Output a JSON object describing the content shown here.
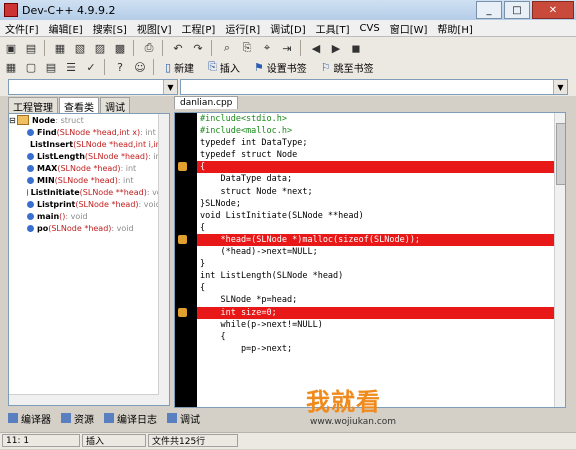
{
  "window": {
    "title": "Dev-C++ 4.9.9.2"
  },
  "menu": [
    "文件[F]",
    "编辑[E]",
    "搜索[S]",
    "视图[V]",
    "工程[P]",
    "运行[R]",
    "调试[D]",
    "工具[T]",
    "CVS",
    "窗口[W]",
    "帮助[H]"
  ],
  "toolbar2": {
    "new_label": "新建",
    "insert_label": "插入",
    "set_bookmark_label": "设置书签",
    "goto_bookmark_label": "跳至书签"
  },
  "left_tabs": [
    "工程管理",
    "查看类",
    "调试"
  ],
  "class_tree": {
    "root": {
      "name": "Node",
      "type": " : struct"
    },
    "items": [
      {
        "name": "Find",
        "params": "(SLNode *head,int x)",
        "ret": " : int"
      },
      {
        "name": "ListInsert",
        "params": "(SLNode *head,int i,int x)",
        "ret": " : int"
      },
      {
        "name": "ListLength",
        "params": "(SLNode *head)",
        "ret": " : int"
      },
      {
        "name": "MAX",
        "params": "(SLNode *head)",
        "ret": " : int"
      },
      {
        "name": "MIN",
        "params": "(SLNode *head)",
        "ret": " : int"
      },
      {
        "name": "ListInitiate",
        "params": "(SLNode **head)",
        "ret": " : void"
      },
      {
        "name": "Listprint",
        "params": "(SLNode *head)",
        "ret": " : void"
      },
      {
        "name": "main",
        "params": "()",
        "ret": " : void"
      },
      {
        "name": "po",
        "params": "(SLNode *head)",
        "ret": " : void"
      }
    ]
  },
  "editor": {
    "file_tab": "danlian.cpp",
    "lines": [
      {
        "text": "#include<stdio.h>",
        "cls": "pre",
        "bp": false
      },
      {
        "text": "#include<malloc.h>",
        "cls": "pre",
        "bp": false
      },
      {
        "text": "typedef int DataType;",
        "cls": "",
        "bp": false
      },
      {
        "text": "typedef struct Node",
        "cls": "",
        "bp": false
      },
      {
        "text": "{",
        "cls": "hl",
        "bp": true
      },
      {
        "text": "    DataType data;",
        "cls": "",
        "bp": false
      },
      {
        "text": "    struct Node *next;",
        "cls": "",
        "bp": false
      },
      {
        "text": "}SLNode;",
        "cls": "",
        "bp": false
      },
      {
        "text": "void ListInitiate(SLNode **head)",
        "cls": "",
        "bp": false
      },
      {
        "text": "{",
        "cls": "",
        "bp": false
      },
      {
        "text": "    *head=(SLNode *)malloc(sizeof(SLNode));",
        "cls": "hl",
        "bp": true
      },
      {
        "text": "    (*head)->next=NULL;",
        "cls": "",
        "bp": false
      },
      {
        "text": "}",
        "cls": "",
        "bp": false
      },
      {
        "text": "int ListLength(SLNode *head)",
        "cls": "",
        "bp": false
      },
      {
        "text": "{",
        "cls": "",
        "bp": false
      },
      {
        "text": "    SLNode *p=head;",
        "cls": "",
        "bp": false
      },
      {
        "text": "    int size=0;",
        "cls": "hl",
        "bp": true
      },
      {
        "text": "    while(p->next!=NULL)",
        "cls": "",
        "bp": false
      },
      {
        "text": "    {",
        "cls": "",
        "bp": false
      },
      {
        "text": "        p=p->next;",
        "cls": "",
        "bp": false
      }
    ]
  },
  "bottom_tabs": [
    "编译器",
    "资源",
    "编译日志",
    "调试"
  ],
  "status": {
    "position": "11: 1",
    "mode": "插入",
    "info": "文件共125行"
  },
  "watermark": {
    "main": "我就看",
    "sub": "www.wojiukan.com"
  }
}
